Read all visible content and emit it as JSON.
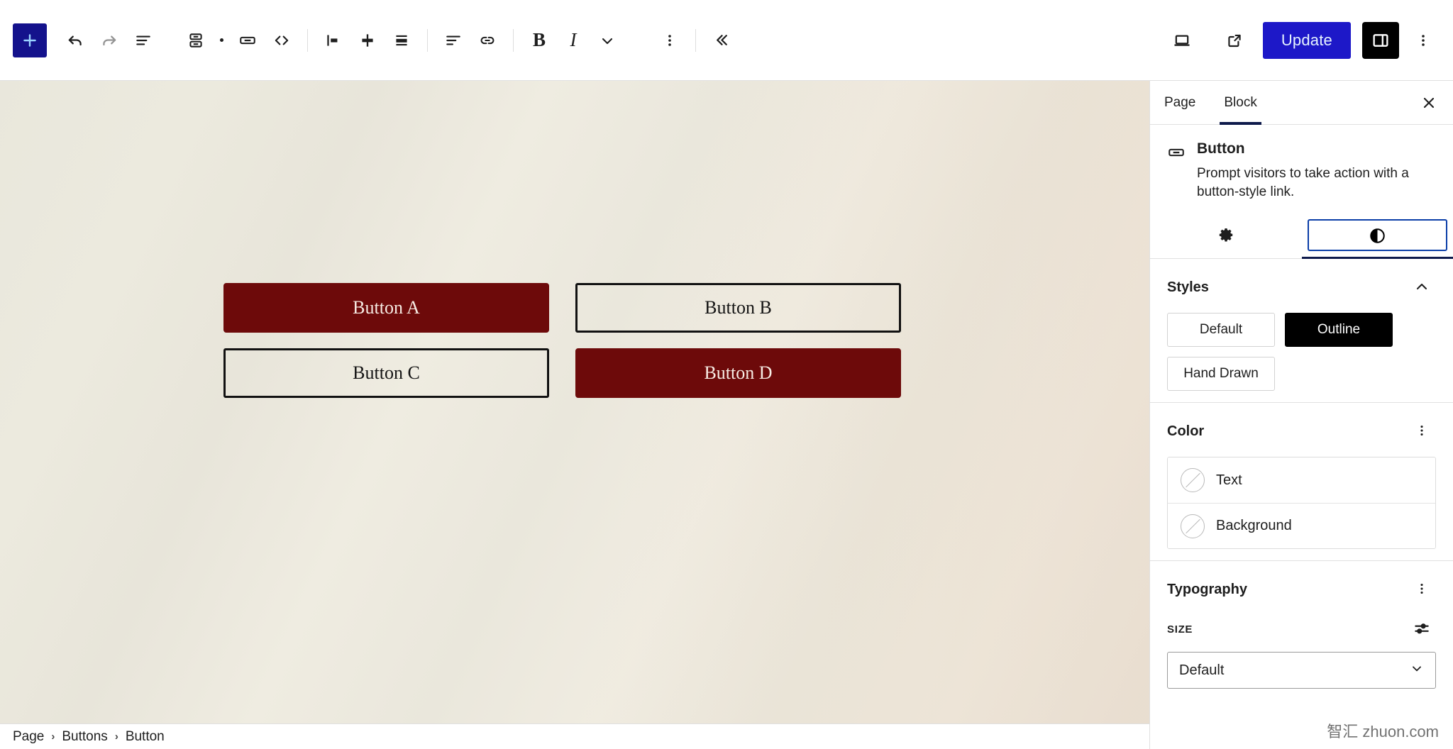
{
  "toolbar": {
    "add_block_label": "Add block",
    "undo_label": "Undo",
    "redo_label": "Redo",
    "list_view_label": "Document Overview",
    "buttons_block_label": "Buttons",
    "button_block_label": "Button",
    "html_label": "Edit as HTML",
    "align_left_label": "Align left",
    "align_center_label": "Align center",
    "align_right_label": "Align right",
    "text_align_label": "Align text",
    "link_label": "Link",
    "bold_label": "Bold",
    "italic_label": "Italic",
    "more_formats_label": "More",
    "options_label": "Options",
    "collapse_label": "Collapse",
    "preview_label": "Preview",
    "view_label": "View",
    "update_label": "Update",
    "settings_toggle_label": "Settings",
    "kebab_label": "Options",
    "accent_color": "#1d18c8",
    "adder_color": "#14128c",
    "toggle_active_color": "#000000"
  },
  "canvas": {
    "buttons": [
      {
        "label": "Button A",
        "style": "filled"
      },
      {
        "label": "Button B",
        "style": "outline"
      },
      {
        "label": "Button C",
        "style": "outline"
      },
      {
        "label": "Button D",
        "style": "filled"
      }
    ],
    "fill_color": "#6d0a0a",
    "fill_text_color": "#f7ece4",
    "outline_border_color": "#111111",
    "background_color": "#eae7db"
  },
  "breadcrumb": {
    "items": [
      "Page",
      "Buttons",
      "Button"
    ],
    "separator": "›"
  },
  "sidebar": {
    "tabs": [
      {
        "label": "Page",
        "active": false
      },
      {
        "label": "Block",
        "active": true
      }
    ],
    "close_label": "Close Settings",
    "block": {
      "icon": "button-block-icon",
      "title": "Button",
      "description": "Prompt visitors to take action with a button-style link."
    },
    "inspector_tabs": [
      {
        "name": "settings-tab",
        "icon": "gear-icon",
        "active": false
      },
      {
        "name": "styles-tab",
        "icon": "contrast-half-circle-icon",
        "active": true
      }
    ],
    "styles": {
      "title": "Styles",
      "collapse_icon": "chevron-up-icon",
      "options": [
        {
          "label": "Default",
          "selected": false
        },
        {
          "label": "Outline",
          "selected": true
        },
        {
          "label": "Hand Drawn",
          "selected": false
        }
      ]
    },
    "color": {
      "title": "Color",
      "menu_icon": "kebab-vertical-icon",
      "items": [
        {
          "label": "Text",
          "value": "none"
        },
        {
          "label": "Background",
          "value": "none"
        }
      ]
    },
    "typography": {
      "title": "Typography",
      "menu_icon": "kebab-vertical-icon",
      "size_label": "SIZE",
      "size_settings_icon": "sliders-icon",
      "size_value": "Default",
      "size_caret_icon": "chevron-down-icon"
    }
  },
  "watermark": {
    "text": "智汇 zhuon.com"
  }
}
